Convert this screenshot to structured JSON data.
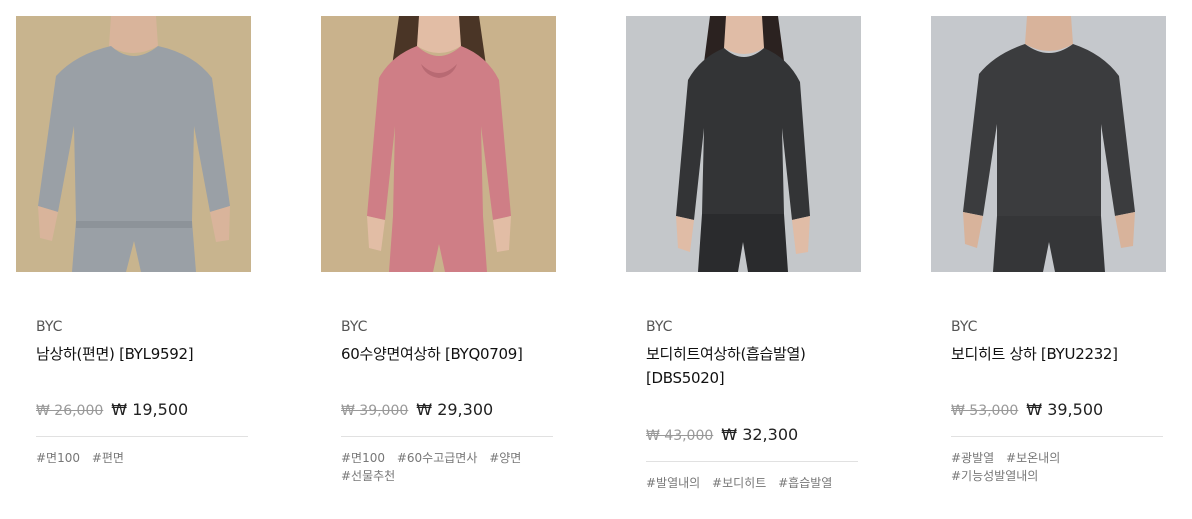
{
  "products": [
    {
      "brand": "BYC",
      "name": "남상하(편면) [BYL9592]",
      "original_price": "₩ 26,000",
      "sale_price": "₩ 19,500",
      "tags": [
        "#면100",
        "#편면"
      ],
      "image_bg": "#c8b48e",
      "garment_color": "#9aa0a6"
    },
    {
      "brand": "BYC",
      "name": "60수양면여상하 [BYQ0709]",
      "original_price": "₩ 39,000",
      "sale_price": "₩ 29,300",
      "tags": [
        "#면100",
        "#60수고급면사",
        "#양면",
        "#선물추천"
      ],
      "image_bg": "#c9b28c",
      "garment_color": "#cf7e86"
    },
    {
      "brand": "BYC",
      "name": "보디히트여상하(흡습발열) [DBS5020]",
      "original_price": "₩ 43,000",
      "sale_price": "₩ 32,300",
      "tags": [
        "#발열내의",
        "#보디히트",
        "#흡습발열"
      ],
      "image_bg": "#c4c7ca",
      "garment_color": "#333436"
    },
    {
      "brand": "BYC",
      "name": "보디히트 상하 [BYU2232]",
      "original_price": "₩ 53,000",
      "sale_price": "₩ 39,500",
      "tags": [
        "#광발열",
        "#보온내의",
        "#기능성발열내의"
      ],
      "image_bg": "#c5c8cc",
      "garment_color": "#3b3c3e"
    }
  ]
}
